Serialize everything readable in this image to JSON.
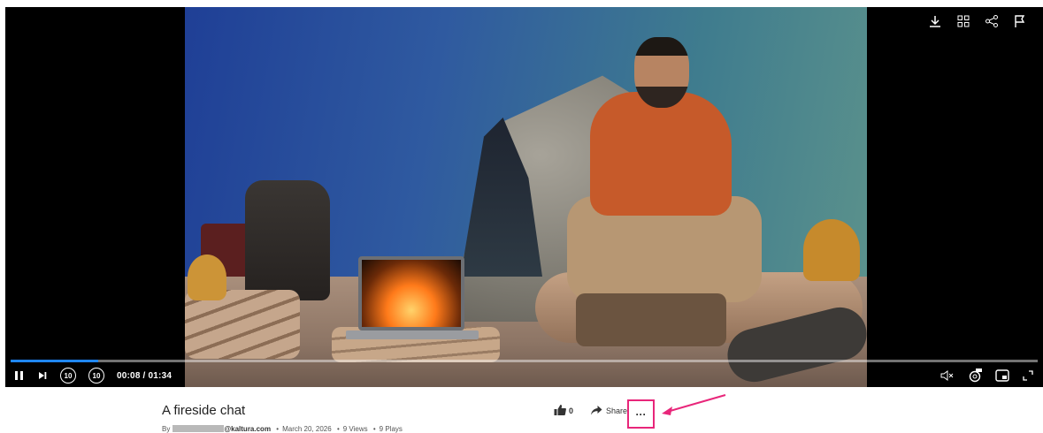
{
  "player": {
    "current_time": "00:08",
    "duration": "01:34",
    "time_text": "00:08 / 01:34",
    "progress_percent": 8.5,
    "seek_back_label": "10",
    "seek_forward_label": "10",
    "top_icons": [
      "download-icon",
      "grid-icon",
      "share-icon",
      "flag-icon"
    ],
    "right_controls": [
      "mute-icon",
      "settings-icon",
      "pip-icon",
      "fullscreen-icon"
    ]
  },
  "media": {
    "title": "A fireside chat",
    "by_label": "By",
    "author_domain": "@kaltura.com",
    "date": "March 20, 2026",
    "views": "9 Views",
    "plays": "9 Plays",
    "separator": "•"
  },
  "actions": {
    "like_count": "0",
    "share_label": "Share",
    "more_label": "···"
  },
  "colors": {
    "accent": "#1f87ff",
    "highlight": "#e8267a"
  }
}
